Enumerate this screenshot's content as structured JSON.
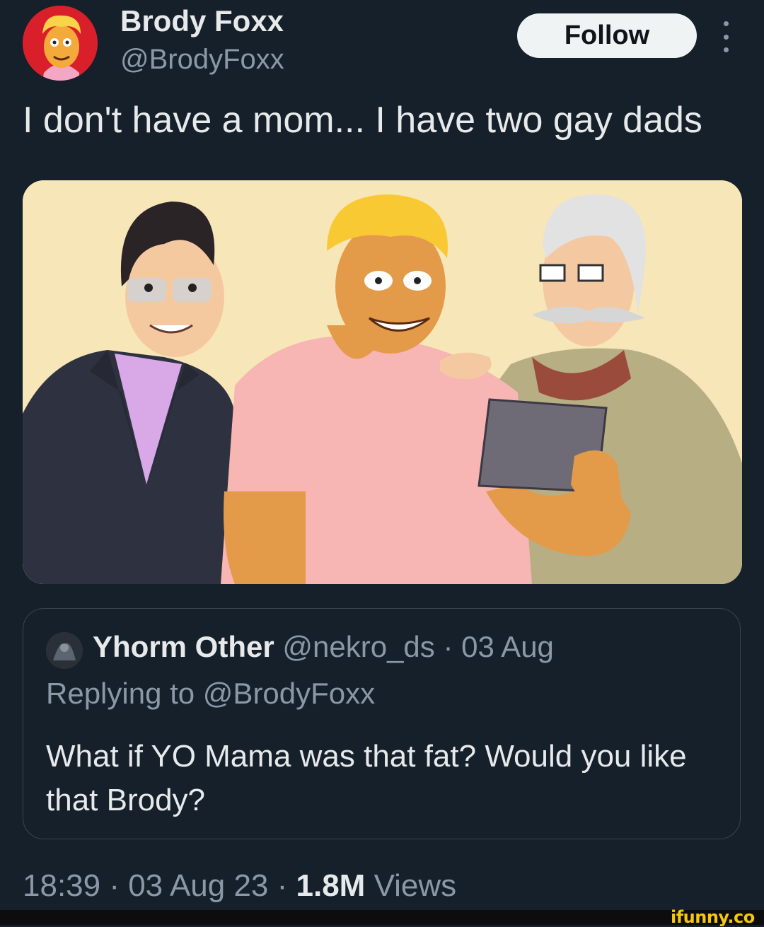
{
  "author": {
    "display_name": "Brody Foxx",
    "handle": "@BrodyFoxx"
  },
  "follow_label": "Follow",
  "tweet_text": "I don't have a mom... I have two gay dads",
  "quote": {
    "name": "Yhorm Other",
    "meta": "@nekro_ds · 03 Aug",
    "replying_to": "Replying to @BrodyFoxx",
    "text": "What if YO Mama was that fat? Would you like that Brody?"
  },
  "footer": {
    "time_date": "18:39 · 03 Aug 23 · ",
    "views_count": "1.8M",
    "views_label": "Views"
  },
  "watermark": "ifunny.co",
  "colors": {
    "background": "#15202b",
    "text": "#e7e9ea",
    "secondary": "#8b98a5",
    "border": "#38444d",
    "follow_bg": "#eff3f4",
    "watermark": "#f6c70a"
  }
}
